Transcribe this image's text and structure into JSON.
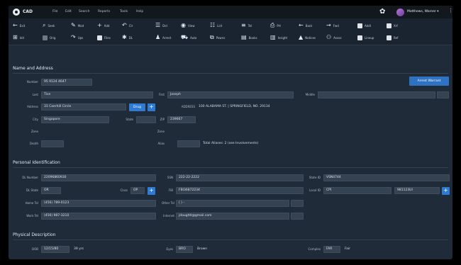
{
  "title": {
    "app": "CAD",
    "menus": [
      "File",
      "Edit",
      "Search",
      "Reports",
      "Tools",
      "Help"
    ],
    "user": "Matthews, Warner",
    "user_caret": "▾",
    "settings_glyph": "✿",
    "more_glyph": "⋮"
  },
  "toolbar": {
    "row1": [
      {
        "icon": "arrow-left-icon",
        "glyph": "←",
        "label": "Exit"
      },
      {
        "icon": "search-icon",
        "glyph": "⌕",
        "label": "Seek"
      },
      {
        "icon": "pencil-icon",
        "glyph": "✎",
        "label": "Mod"
      },
      {
        "icon": "plus-icon",
        "glyph": "+",
        "label": "Add"
      },
      {
        "icon": "undo-icon",
        "glyph": "↶",
        "label": "Clr"
      },
      {
        "icon": "list-icon",
        "glyph": "☰",
        "label": "Del"
      },
      {
        "icon": "eye-icon",
        "glyph": "◉",
        "label": "View"
      },
      {
        "icon": "grid-list-icon",
        "glyph": "☷",
        "label": "List"
      },
      {
        "icon": "lines-icon",
        "glyph": "≡",
        "label": "Tel"
      },
      {
        "icon": "printer-icon",
        "glyph": "⎙",
        "label": "Prt"
      },
      {
        "icon": "back-icon",
        "glyph": "←",
        "label": "Back"
      },
      {
        "icon": "forward-icon",
        "glyph": "→",
        "label": "Fwd"
      },
      {
        "icon": "doc-icon",
        "glyph": "",
        "label": "Addl"
      },
      {
        "icon": "doc-icon",
        "glyph": "",
        "label": "Xrf"
      }
    ],
    "row2": [
      {
        "icon": "grid-icon",
        "glyph": "⊞",
        "label": "Init"
      },
      {
        "icon": "doc-dim-icon",
        "glyph": "",
        "label": "Orig"
      },
      {
        "icon": "redo-icon",
        "glyph": "↷",
        "label": "Ups"
      },
      {
        "icon": "file-icon",
        "glyph": "",
        "label": "Files"
      },
      {
        "icon": "gear-icon",
        "glyph": "✱",
        "label": "DL"
      },
      {
        "icon": "person-icon",
        "glyph": "♟",
        "label": "Arrest"
      },
      {
        "icon": "car-icon",
        "glyph": "⛟",
        "label": "Auto"
      },
      {
        "icon": "pawn-icon",
        "glyph": "⧉",
        "label": "Pawns"
      },
      {
        "icon": "book-icon",
        "glyph": "▤",
        "label": "Books"
      },
      {
        "icon": "chart-icon",
        "glyph": "▥",
        "label": "Insight"
      },
      {
        "icon": "alert-icon",
        "glyph": "▲",
        "label": "Notices"
      },
      {
        "icon": "people-icon",
        "glyph": "⚇",
        "label": "Assoc"
      },
      {
        "icon": "doc-icon",
        "glyph": "",
        "label": "Lineup"
      },
      {
        "icon": "doc-icon",
        "glyph": "",
        "label": "Ref"
      }
    ]
  },
  "name_address": {
    "heading": "Name and Address",
    "arrest_btn": "Arrest Warrant",
    "number_label": "Number",
    "number": "95 9124 4647",
    "last_label": "Last",
    "last": "Tice",
    "first_label": "First",
    "first": "Joseph",
    "middle_label": "Middle",
    "middle": "",
    "suffix": "",
    "address_label": "Address",
    "address": "31 Caerhill Circle",
    "drug_btn": "Drug",
    "plus": "+",
    "verified_label": "ADDRESS",
    "verified": "100 ALABAMA ST.  |  SPRINGFIELD,  NO.  29134",
    "city_label": "City",
    "city": "Singapore",
    "state_label": "State",
    "state": "",
    "zip_label": "ZIP",
    "zip": "239667",
    "zone_label": "Zone",
    "zone": "",
    "zone2_label": "Zone",
    "death_label": "Death",
    "death": "",
    "alias_label": "Alias",
    "alias": "",
    "aliases_text": "Total Aliases: 2 (see Involvements)"
  },
  "personal": {
    "heading": "Personal Identification",
    "dl_label": "DL Number",
    "dl": "22096860930",
    "ssn_label": "SSN",
    "ssn": "222-22-2222",
    "state_id_label": "State ID",
    "state_id": "VSN4744",
    "dl_state_label": "DL State",
    "dl_state": "OR",
    "class_label": "Class",
    "class": "OP",
    "plus": "+",
    "fbi_label": "FBI",
    "fbi": "FBI36872234",
    "local_id_label": "Local ID",
    "local_id_type": "CPI",
    "local_id": "981123UI",
    "home_label": "Home Tel",
    "home": "(456) 789-0123",
    "other_label": "Other Tel",
    "other": "(  )  -",
    "work_label": "Work Tel",
    "work": "(456) 987-3210",
    "email_label": "Internet",
    "email": "jdoughtl@gmail.com"
  },
  "physical": {
    "heading": "Physical Description",
    "dob_label": "DOB",
    "dob": "12/15/80",
    "age": "39 yrs",
    "eyes_label": "Eyes",
    "eyes_code": "BRO",
    "eyes": "Brown",
    "complex_label": "Complex",
    "complex_code": "FAR",
    "complex": "Fair"
  }
}
